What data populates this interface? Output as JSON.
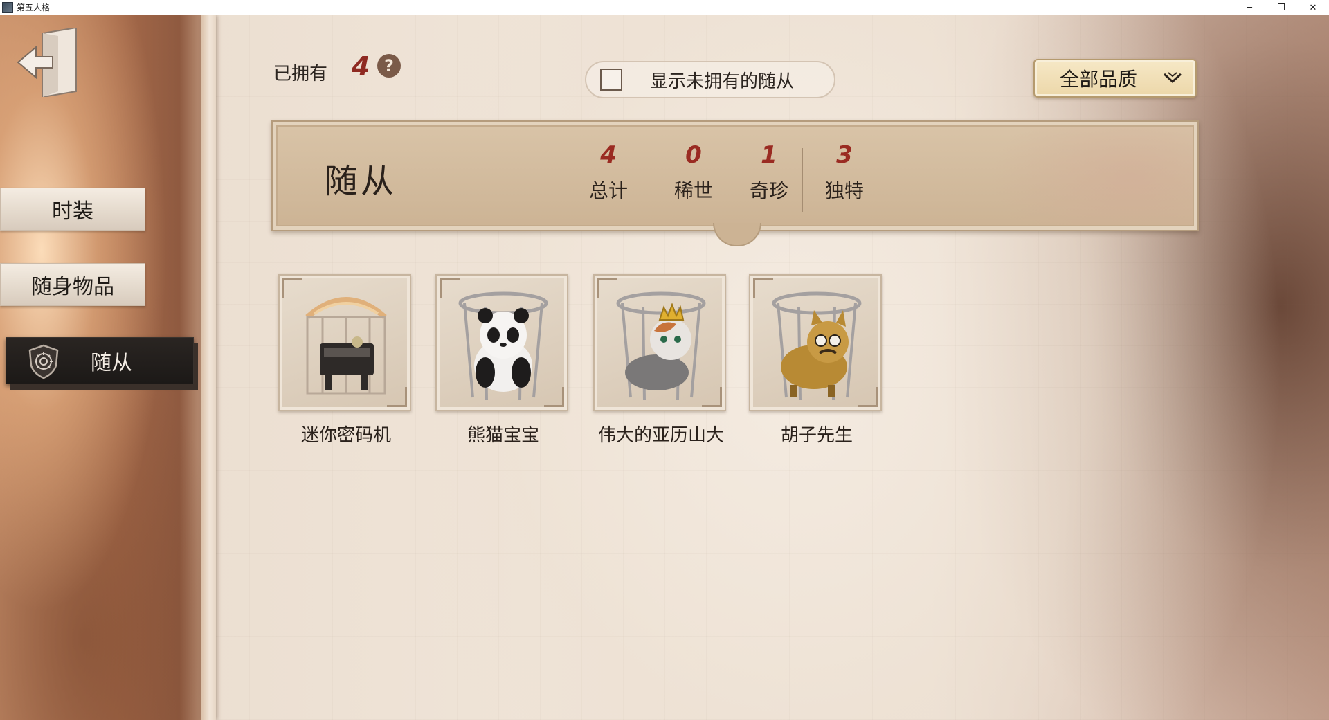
{
  "window": {
    "title": "第五人格",
    "controls": {
      "minimize": "─",
      "restore": "❐",
      "close": "✕"
    }
  },
  "sidebar": {
    "nav": [
      {
        "label": "时装",
        "active": false
      },
      {
        "label": "随身物品",
        "active": false
      },
      {
        "label": "随从",
        "active": true
      }
    ]
  },
  "header": {
    "owned_label": "已拥有",
    "owned_count": "4",
    "help_glyph": "?",
    "show_unowned_label": "显示未拥有的随从",
    "show_unowned_checked": false,
    "quality_filter": "全部品质"
  },
  "banner": {
    "title": "随从",
    "stats": [
      {
        "value": "4",
        "label": "总计"
      },
      {
        "value": "0",
        "label": "稀世"
      },
      {
        "value": "1",
        "label": "奇珍"
      },
      {
        "value": "3",
        "label": "独特"
      }
    ]
  },
  "pets": [
    {
      "name": "迷你密码机",
      "icon": "mini-cipher-machine-icon"
    },
    {
      "name": "熊猫宝宝",
      "icon": "panda-icon"
    },
    {
      "name": "伟大的亚历山大",
      "icon": "crowned-cat-icon"
    },
    {
      "name": "胡子先生",
      "icon": "mustache-cat-icon"
    }
  ],
  "colors": {
    "accent_red": "#9a2b22",
    "dark_nav": "#1c1917",
    "parchment": "#e9ddcf"
  }
}
